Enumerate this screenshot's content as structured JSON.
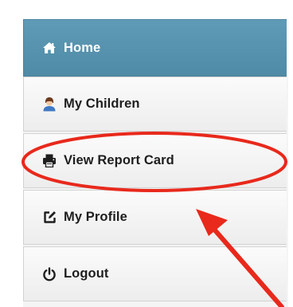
{
  "nav": {
    "items": [
      {
        "label": "Home",
        "icon": "home-icon",
        "active": true
      },
      {
        "label": "My Children",
        "icon": "user-icon",
        "active": false
      },
      {
        "label": "View Report Card",
        "icon": "printer-icon",
        "active": false
      },
      {
        "label": "My Profile",
        "icon": "edit-icon",
        "active": false
      },
      {
        "label": "Logout",
        "icon": "power-icon",
        "active": false
      }
    ]
  },
  "colors": {
    "active_bg": "#5a95b1",
    "item_bg": "#f2f2f2",
    "annotation": "#e8291c"
  }
}
